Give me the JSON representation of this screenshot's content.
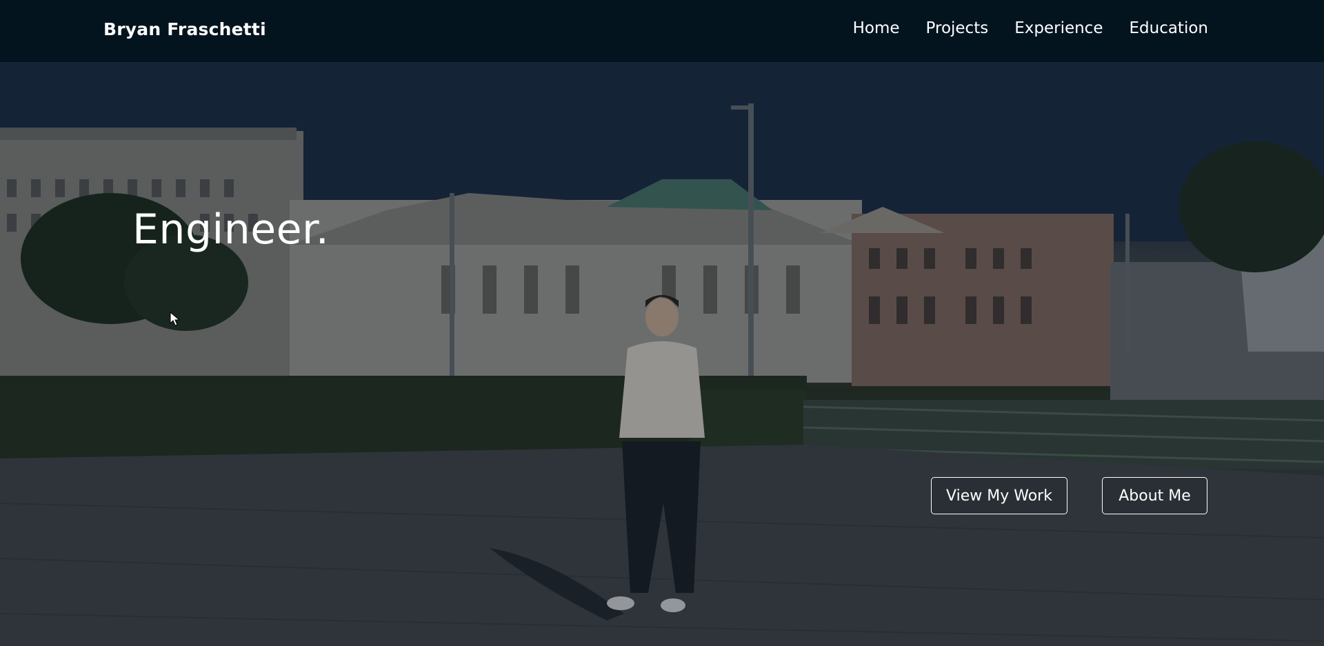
{
  "nav": {
    "brand": "Bryan Fraschetti",
    "links": [
      "Home",
      "Projects",
      "Experience",
      "Education"
    ]
  },
  "hero": {
    "headline": "Engineer.",
    "buttons": {
      "view_work": "View My Work",
      "about_me": "About Me"
    },
    "background_icon": "photo-person-standing-in-city-square"
  },
  "colors": {
    "navbar_bg": "#04141f",
    "text": "#ffffff"
  }
}
